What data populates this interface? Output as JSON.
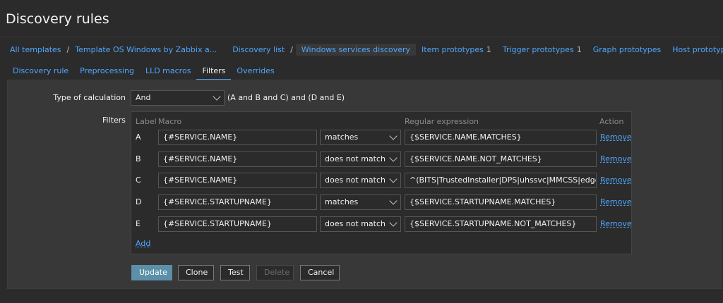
{
  "page": {
    "title": "Discovery rules"
  },
  "breadcrumb": [
    {
      "label": "All templates",
      "sep": "/"
    },
    {
      "label": "Template OS Windows by Zabbix a...",
      "sep": ""
    },
    {
      "label": "Discovery list",
      "sep": "/"
    },
    {
      "label": "Windows services discovery",
      "active": true
    },
    {
      "label": "Item prototypes",
      "count": "1"
    },
    {
      "label": "Trigger prototypes",
      "count": "1"
    },
    {
      "label": "Graph prototypes"
    },
    {
      "label": "Host prototypes"
    }
  ],
  "tabs": [
    {
      "label": "Discovery rule"
    },
    {
      "label": "Preprocessing"
    },
    {
      "label": "LLD macros"
    },
    {
      "label": "Filters",
      "active": true
    },
    {
      "label": "Overrides"
    }
  ],
  "form": {
    "calc_label": "Type of calculation",
    "calc_value": "And",
    "calc_formula": "(A and B and C) and (D and E)",
    "filters_label": "Filters",
    "columns": {
      "label": "Label",
      "macro": "Macro",
      "regex": "Regular expression",
      "action": "Action"
    },
    "rows": [
      {
        "label": "A",
        "macro": "{#SERVICE.NAME}",
        "operator": "matches",
        "regex": "{$SERVICE.NAME.MATCHES}",
        "action": "Remove"
      },
      {
        "label": "B",
        "macro": "{#SERVICE.NAME}",
        "operator": "does not match",
        "regex": "{$SERVICE.NAME.NOT_MATCHES}",
        "action": "Remove"
      },
      {
        "label": "C",
        "macro": "{#SERVICE.NAME}",
        "operator": "does not match",
        "regex": "^(BITS|TrustedInstaller|DPS|uhssvc|MMCSS|edgeupd",
        "action": "Remove"
      },
      {
        "label": "D",
        "macro": "{#SERVICE.STARTUPNAME}",
        "operator": "matches",
        "regex": "{$SERVICE.STARTUPNAME.MATCHES}",
        "action": "Remove"
      },
      {
        "label": "E",
        "macro": "{#SERVICE.STARTUPNAME}",
        "operator": "does not match",
        "regex": "{$SERVICE.STARTUPNAME.NOT_MATCHES}",
        "action": "Remove"
      }
    ],
    "add_label": "Add"
  },
  "buttons": {
    "update": "Update",
    "clone": "Clone",
    "test": "Test",
    "delete": "Delete",
    "cancel": "Cancel"
  }
}
